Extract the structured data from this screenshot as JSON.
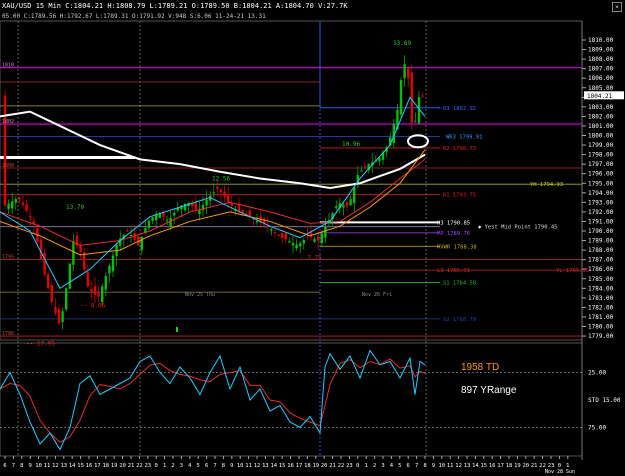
{
  "window": {
    "title": "XAU/USD  15 Min  C:1804.21  H:1808.79  L:1789.21  O:1789.50  B:1804.21  A:1804.70  V:27.7K",
    "subtitle": "05.00  C:1789.56  H:1792.67  L:1789.31  O:1791.92  V:948  S:6.06  11-24-21  13.31",
    "close_glyph": "×"
  },
  "colors": {
    "up_candle": "#00c000",
    "down_candle": "#e00000",
    "ma_white": "#ffffff",
    "ma_red": "#e03030",
    "ma_orange": "#ff9900",
    "ma_cyan": "#22ccff",
    "stoch_main": "#22ccff",
    "stoch_signal": "#e03030",
    "magenta": "#e000e0"
  },
  "price_axis": {
    "labels": [
      "1810.00",
      "1809.00",
      "1808.00",
      "1807.00",
      "1806.00",
      "1805.00",
      "1804.00",
      "1803.00",
      "1802.00",
      "1801.00",
      "1800.00",
      "1799.00",
      "1798.00",
      "1797.00",
      "1796.00",
      "1795.00",
      "1794.00",
      "1793.00",
      "1792.00",
      "1791.00",
      "1790.00",
      "1789.00",
      "1788.00",
      "1787.00",
      "1786.00",
      "1785.00",
      "1784.00",
      "1783.00",
      "1782.00",
      "1781.00",
      "1780.00",
      "1779.00"
    ],
    "current": "1804.21"
  },
  "levels": {
    "r3": "R3  1802.92",
    "wr3": "WR3  1799.91",
    "r2": "R2  1798.73",
    "yh": "YH  1794.93",
    "r1": "R1  1793.75",
    "h3": "H3  1790.85",
    "mid": "Yest Mid Point 1790.45",
    "pp": "PP  1789.76",
    "rvwr": "RVWR  1788.38",
    "l3": "L3  1785.91",
    "yl": "YL  1785.96",
    "s1": "S1  1784.58",
    "s2": "S2  1780.79",
    "left_top": "1810",
    "left_mid": "1802",
    "left_a": "1800",
    "left_b": "1795",
    "left_c": "1786"
  },
  "annotations": {
    "peak": "13.69",
    "a1": "10.96",
    "a2": "12.56",
    "a3": "13.79",
    "low1": "8.06",
    "low2": "17.95",
    "low3": "7.75"
  },
  "date_labels": {
    "d1": "Nov 25 Thu",
    "d2": "Nov 26 Fri",
    "d3": "Nov 28 Sun"
  },
  "time_axis": [
    "6",
    "7",
    "8",
    "9",
    "10",
    "11",
    "12",
    "13",
    "14",
    "15",
    "16",
    "17",
    "18",
    "19",
    "20",
    "21",
    "22",
    "23",
    "0",
    "1",
    "2",
    "3",
    "4",
    "5",
    "6",
    "7",
    "8",
    "9",
    "10",
    "11",
    "12",
    "13",
    "14",
    "15",
    "16",
    "17",
    "18",
    "19",
    "20",
    "21",
    "22",
    "23",
    "0",
    "1",
    "2",
    "3",
    "4",
    "5",
    "6",
    "7",
    "8",
    "9",
    "10",
    "11",
    "12",
    "13",
    "14",
    "15",
    "16",
    "17",
    "18",
    "19",
    "20",
    "21",
    "22",
    "23",
    "0",
    "1"
  ],
  "indicator": {
    "td": "1958 TD",
    "yrange": "897 YRange",
    "axis": [
      "25.00",
      "STO 15.00",
      "75.00"
    ]
  }
}
